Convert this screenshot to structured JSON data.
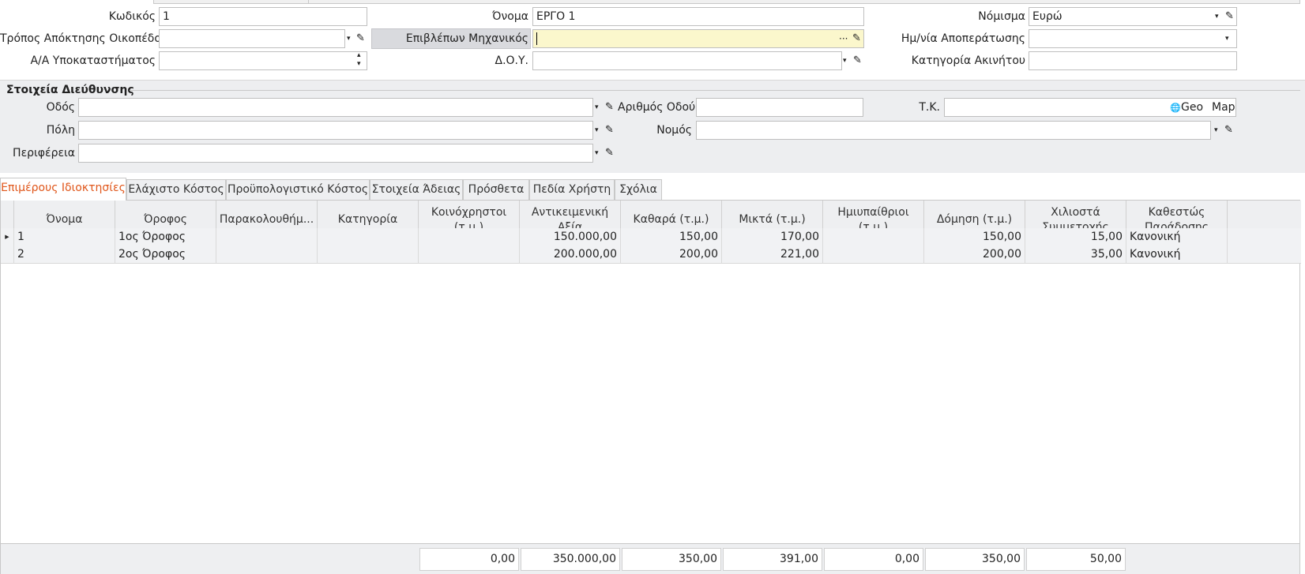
{
  "header": {
    "code_label": "Κωδικός",
    "code_value": "1",
    "name_label": "Όνομα",
    "name_value": "ΕΡΓΟ 1",
    "currency_label": "Νόμισμα",
    "currency_value": "Ευρώ",
    "acquisition_label": "Τρόπος Απόκτησης Οικοπέδου",
    "acquisition_value": "",
    "engineer_label": "Επιβλέπων Μηχανικός",
    "engineer_value": "",
    "completion_label": "Ημ/νία Αποπεράτωσης",
    "completion_value": "",
    "branch_label": "Α/Α Υποκαταστήματος",
    "branch_value": "",
    "doy_label": "Δ.Ο.Υ.",
    "doy_value": "",
    "category_label": "Κατηγορία Ακινήτου",
    "category_value": ""
  },
  "address": {
    "title": "Στοιχεία Διεύθυνσης",
    "street_label": "Οδός",
    "street_number_label": "Αριθμός Οδού",
    "postal_label": "Τ.Κ.",
    "geo_label": "Geo",
    "map_label": "Map",
    "city_label": "Πόλη",
    "prefecture_label": "Νομός",
    "region_label": "Περιφέρεια"
  },
  "tabs": [
    {
      "label": "Επιμέρους Ιδιοκτησίες",
      "active": true
    },
    {
      "label": "Ελάχιστο Κόστος"
    },
    {
      "label": "Προϋπολογιστικό Κόστος"
    },
    {
      "label": "Στοιχεία Άδειας"
    },
    {
      "label": "Πρόσθετα"
    },
    {
      "label": "Πεδία Χρήστη"
    },
    {
      "label": "Σχόλια"
    }
  ],
  "grid": {
    "columns": [
      "Όνομα",
      "Όροφος",
      "Παρακολουθήμ...",
      "Κατηγορία",
      "Κοινόχρηστοι\n(τ.μ.)",
      "Αντικειμενική\nΑξία",
      "Καθαρά (τ.μ.)",
      "Μικτά (τ.μ.)",
      "Ημιυπαίθριοι\n(τ.μ.)",
      "Δόμηση (τ.μ.)",
      "Χιλιοστά\nΣυμμετοχής",
      "Καθεστώς\nΠαράδοσης"
    ],
    "rows": [
      [
        "1",
        "1ος Όροφος",
        "",
        "",
        "",
        "150.000,00",
        "150,00",
        "170,00",
        "",
        "150,00",
        "15,00",
        "Κανονική"
      ],
      [
        "2",
        "2ος Όροφος",
        "",
        "",
        "",
        "200.000,00",
        "200,00",
        "221,00",
        "",
        "200,00",
        "35,00",
        "Κανονική"
      ]
    ],
    "totals": [
      "0,00",
      "350.000,00",
      "350,00",
      "391,00",
      "0,00",
      "350,00",
      "50,00"
    ]
  },
  "icons": {
    "dropdown": "▾",
    "edit": "✎",
    "ellipsis": "···",
    "spin_up": "▴",
    "spin_down": "▾",
    "row_indicator": "▶",
    "globe": "🌐"
  }
}
